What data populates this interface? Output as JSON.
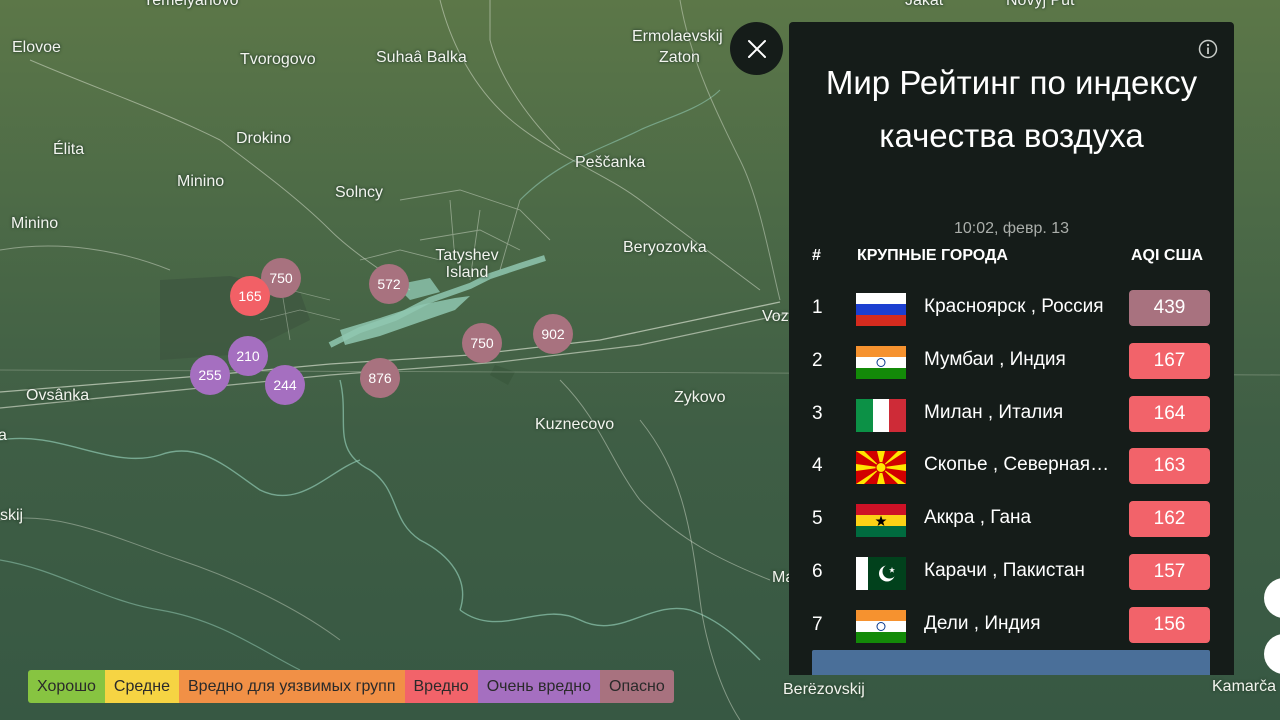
{
  "map": {
    "place_labels": [
      {
        "id": "yemelyanovo",
        "text": "Yemelyanovo"
      },
      {
        "id": "elovoe",
        "text": "Elovoe"
      },
      {
        "id": "tvorogovo",
        "text": "Tvorogovo"
      },
      {
        "id": "suhaa-balka",
        "text": "Suhaâ Balka"
      },
      {
        "id": "ermolaevskij",
        "text": "Ermolaevskij"
      },
      {
        "id": "zaton",
        "text": "Zaton"
      },
      {
        "id": "jakat",
        "text": "Jakat"
      },
      {
        "id": "novyj-put",
        "text": "Novyj Put"
      },
      {
        "id": "drokino",
        "text": "Drokino"
      },
      {
        "id": "elita",
        "text": "Élita"
      },
      {
        "id": "minino-1",
        "text": "Minino"
      },
      {
        "id": "solncy",
        "text": "Solncy"
      },
      {
        "id": "pescanka",
        "text": "Peščanka"
      },
      {
        "id": "minino-2",
        "text": "Minino"
      },
      {
        "id": "beryozovka",
        "text": "Beryozovka"
      },
      {
        "id": "tatyshev",
        "text": "Tatyshev Island"
      },
      {
        "id": "voz",
        "text": "Voz"
      },
      {
        "id": "ovsanka",
        "text": "Ovsânka"
      },
      {
        "id": "zykovo",
        "text": "Zykovo"
      },
      {
        "id": "kuznecovo",
        "text": "Kuznecovo"
      },
      {
        "id": "a-left",
        "text": "a"
      },
      {
        "id": "skij",
        "text": "skij"
      },
      {
        "id": "ma",
        "text": "Ma"
      },
      {
        "id": "berezovskij",
        "text": "Berëzovskij"
      },
      {
        "id": "kamarca",
        "text": "Kamarča"
      }
    ],
    "markers": [
      {
        "value": "750",
        "color": "#a8727f"
      },
      {
        "value": "165",
        "color": "#f26066"
      },
      {
        "value": "572",
        "color": "#a8727f"
      },
      {
        "value": "750",
        "color": "#a8727f"
      },
      {
        "value": "902",
        "color": "#a8727f"
      },
      {
        "value": "210",
        "color": "#a56fc0"
      },
      {
        "value": "255",
        "color": "#a56fc0"
      },
      {
        "value": "244",
        "color": "#a56fc0"
      },
      {
        "value": "876",
        "color": "#a8727f"
      }
    ]
  },
  "legend": [
    {
      "label": "Хорошо",
      "color": "#87c441"
    },
    {
      "label": "Средне",
      "color": "#f6d443"
    },
    {
      "label": "Вредно для уязвимых групп",
      "color": "#f19046"
    },
    {
      "label": "Вредно",
      "color": "#f2636a"
    },
    {
      "label": "Очень вредно",
      "color": "#a56fc0"
    },
    {
      "label": "Опасно",
      "color": "#a8727f"
    }
  ],
  "panel": {
    "close_icon": "close-icon",
    "info_icon": "info-icon",
    "title": "Мир Рейтинг по индексу качества воздуха",
    "timestamp": "10:02, февр. 13",
    "columns": {
      "rank": "#",
      "city": "КРУПНЫЕ ГОРОДА",
      "aqi": "AQI США"
    },
    "rows": [
      {
        "rank": "1",
        "flag": "russia",
        "city": "Красноярск , Россия",
        "aqi": "439",
        "color": "#a8727f"
      },
      {
        "rank": "2",
        "flag": "india",
        "city": "Мумбаи , Индия",
        "aqi": "167",
        "color": "#f2636a"
      },
      {
        "rank": "3",
        "flag": "italy",
        "city": "Милан , Италия",
        "aqi": "164",
        "color": "#f2636a"
      },
      {
        "rank": "4",
        "flag": "north-macedonia",
        "city": "Скопье , Северная Македония",
        "aqi": "163",
        "color": "#f2636a"
      },
      {
        "rank": "5",
        "flag": "ghana",
        "city": "Аккра , Гана",
        "aqi": "162",
        "color": "#f2636a"
      },
      {
        "rank": "6",
        "flag": "pakistan",
        "city": "Карачи , Пакистан",
        "aqi": "157",
        "color": "#f2636a"
      },
      {
        "rank": "7",
        "flag": "india",
        "city": "Дели , Индия",
        "aqi": "156",
        "color": "#f2636a"
      }
    ]
  }
}
